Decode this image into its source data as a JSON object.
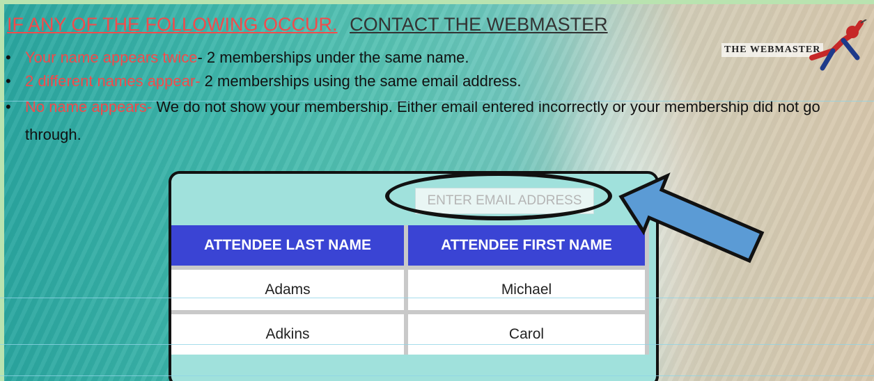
{
  "header": {
    "warning": "IF ANY OF THE FOLLOWING OCCUR.",
    "contact": "CONTACT THE WEBMASTER"
  },
  "bullets": [
    {
      "red": "Your name appears twice",
      "text": "-  2 memberships under the same name."
    },
    {
      "red": "2 different names appear-",
      "text": "  2 memberships using the same email address."
    },
    {
      "red": "No name appears-",
      "text": " We do not show your membership. Either email entered incorrectly or your membership did not go through."
    }
  ],
  "logo": {
    "text": "THE WEBMASTER"
  },
  "search": {
    "placeholder": "ENTER EMAIL ADDRESS"
  },
  "table": {
    "headers": [
      "ATTENDEE LAST NAME",
      "ATTENDEE FIRST NAME"
    ],
    "rows": [
      [
        "Adams",
        "Michael"
      ],
      [
        "Adkins",
        "Carol"
      ]
    ]
  },
  "colors": {
    "warning_red": "#f24b4b",
    "header_blue": "#3a44d4",
    "widget_bg": "#a0e1dc",
    "arrow_blue": "#5b9bd5"
  },
  "icons": {
    "logo": "spiderman-webmaster-logo",
    "arrow": "arrow-left-icon"
  }
}
